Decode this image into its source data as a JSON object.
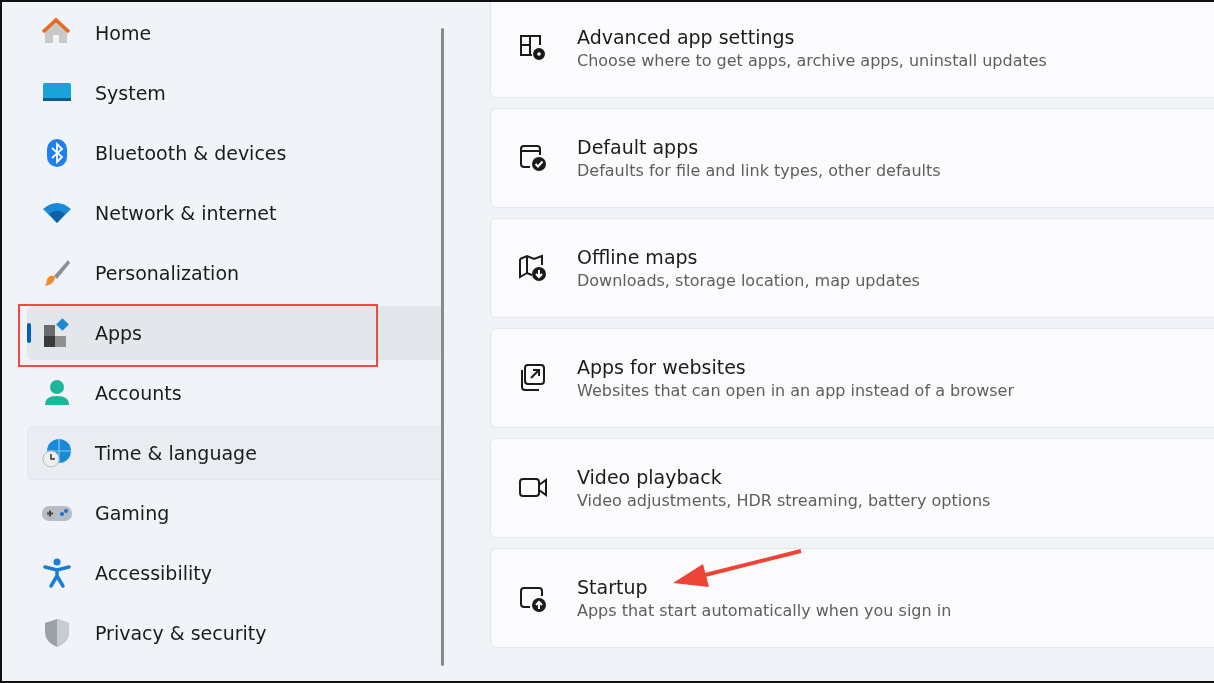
{
  "sidebar": {
    "items": [
      {
        "label": "Home",
        "selected": false,
        "hovered": false,
        "outlined": false
      },
      {
        "label": "System",
        "selected": false,
        "hovered": false,
        "outlined": false
      },
      {
        "label": "Bluetooth & devices",
        "selected": false,
        "hovered": false,
        "outlined": false
      },
      {
        "label": "Network & internet",
        "selected": false,
        "hovered": false,
        "outlined": false
      },
      {
        "label": "Personalization",
        "selected": false,
        "hovered": false,
        "outlined": false
      },
      {
        "label": "Apps",
        "selected": true,
        "hovered": false,
        "outlined": true
      },
      {
        "label": "Accounts",
        "selected": false,
        "hovered": false,
        "outlined": false
      },
      {
        "label": "Time & language",
        "selected": false,
        "hovered": true,
        "outlined": false
      },
      {
        "label": "Gaming",
        "selected": false,
        "hovered": false,
        "outlined": false
      },
      {
        "label": "Accessibility",
        "selected": false,
        "hovered": false,
        "outlined": false
      },
      {
        "label": "Privacy & security",
        "selected": false,
        "hovered": false,
        "outlined": false
      }
    ]
  },
  "settings": [
    {
      "title": "Advanced app settings",
      "description": "Choose where to get apps, archive apps, uninstall updates",
      "arrow": false
    },
    {
      "title": "Default apps",
      "description": "Defaults for file and link types, other defaults",
      "arrow": false
    },
    {
      "title": "Offline maps",
      "description": "Downloads, storage location, map updates",
      "arrow": false
    },
    {
      "title": "Apps for websites",
      "description": "Websites that can open in an app instead of a browser",
      "arrow": false
    },
    {
      "title": "Video playback",
      "description": "Video adjustments, HDR streaming, battery options",
      "arrow": false
    },
    {
      "title": "Startup",
      "description": "Apps that start automatically when you sign in",
      "arrow": true
    }
  ]
}
